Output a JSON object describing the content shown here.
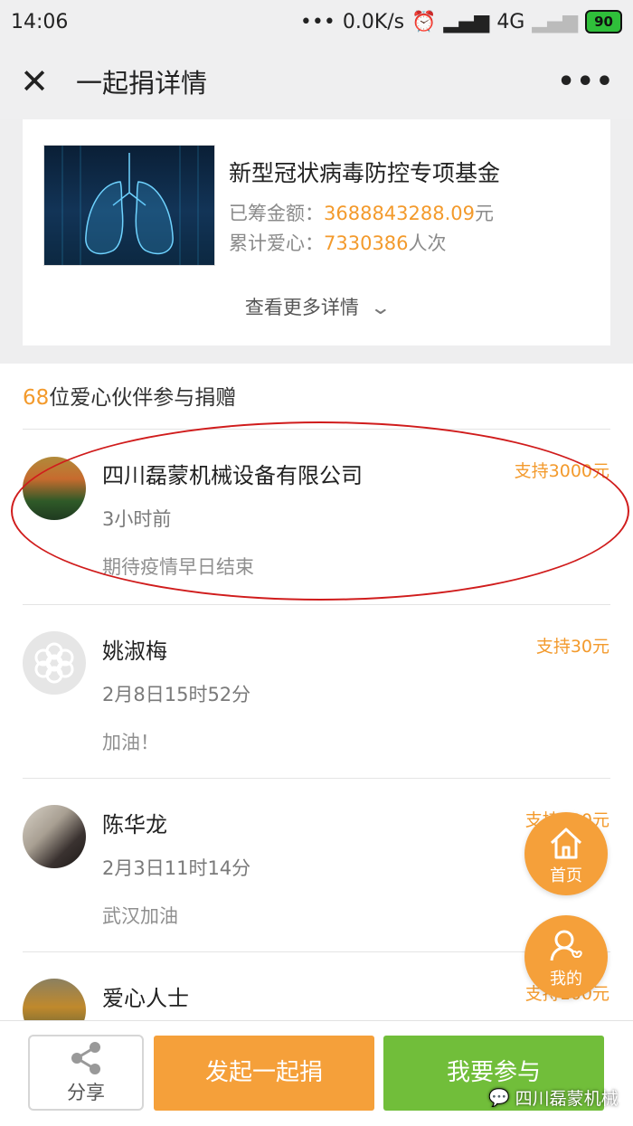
{
  "status_bar": {
    "time": "14:06",
    "network_speed": "0.0K/s",
    "network_type": "4G",
    "battery": "90"
  },
  "header": {
    "title": "一起捐详情"
  },
  "fund": {
    "title": "新型冠状病毒防控专项基金",
    "raised_label": "已筹金额：",
    "raised_value": "3688843288.09",
    "raised_unit": "元",
    "hearts_label": "累计爱心：",
    "hearts_value": "7330386",
    "hearts_unit": "人次",
    "more_label": "查看更多详情"
  },
  "donors_header": {
    "count": "68",
    "text": "位爱心伙伴参与捐赠"
  },
  "donors": [
    {
      "name": "四川磊蒙机械设备有限公司",
      "time": "3小时前",
      "message": "期待疫情早日结束",
      "amount": "支持3000元"
    },
    {
      "name": "姚淑梅",
      "time": "2月8日15时52分",
      "message": "加油！",
      "amount": "支持30元"
    },
    {
      "name": "陈华龙",
      "time": "2月3日11时14分",
      "message": "武汉加油",
      "amount": "支持100元"
    },
    {
      "name": "爱心人士",
      "time": "",
      "message": "",
      "amount": "支持100元"
    }
  ],
  "floating": {
    "home_label": "首页",
    "me_label": "我的"
  },
  "bottom_bar": {
    "share_label": "分享",
    "start_label": "发起一起捐",
    "join_label": "我要参与"
  },
  "watermark": "四川磊蒙机械",
  "colors": {
    "accent_orange": "#f5a03a",
    "amount_orange": "#f39a2c",
    "join_green": "#71be3a",
    "highlight_red": "#d01c1c"
  }
}
